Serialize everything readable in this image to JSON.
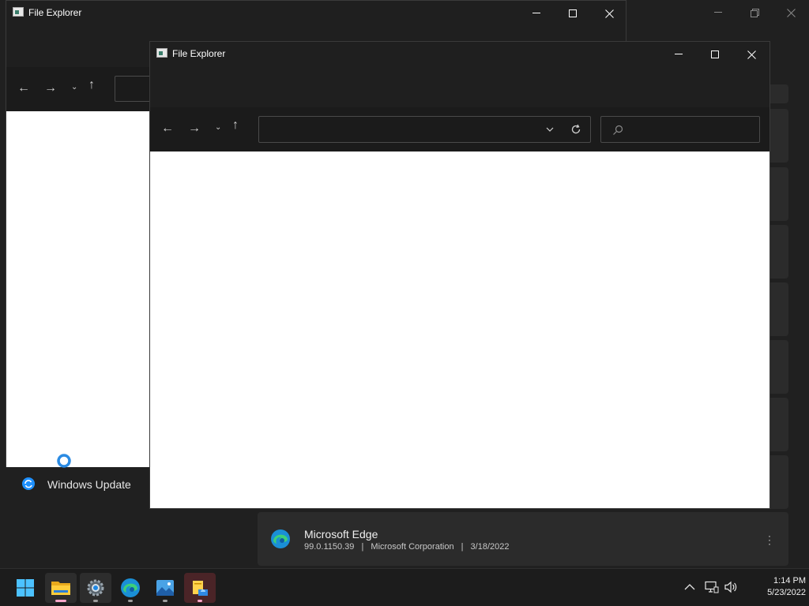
{
  "explorer_back": {
    "title": "File Explorer"
  },
  "explorer_front": {
    "title": "File Explorer"
  },
  "settings": {
    "sidebar_item_windows_update": "Windows Update",
    "app": {
      "name": "Microsoft Edge",
      "version": "99.0.1150.39",
      "publisher": "Microsoft Corporation",
      "date": "3/18/2022",
      "separator": "|"
    }
  },
  "taskbar": {
    "time": "1:14 PM",
    "date": "5/23/2022",
    "accent": "#0078d4"
  },
  "icons": [
    "file-explorer-icon",
    "back-arrow-icon",
    "forward-arrow-icon",
    "recent-locations-chevron-icon",
    "up-arrow-icon",
    "refresh-icon",
    "search-icon",
    "minimize-icon",
    "maximize-icon",
    "close-icon",
    "start-icon",
    "settings-icon",
    "edge-icon",
    "photos-icon",
    "windows-update-icon",
    "more-options-icon"
  ]
}
